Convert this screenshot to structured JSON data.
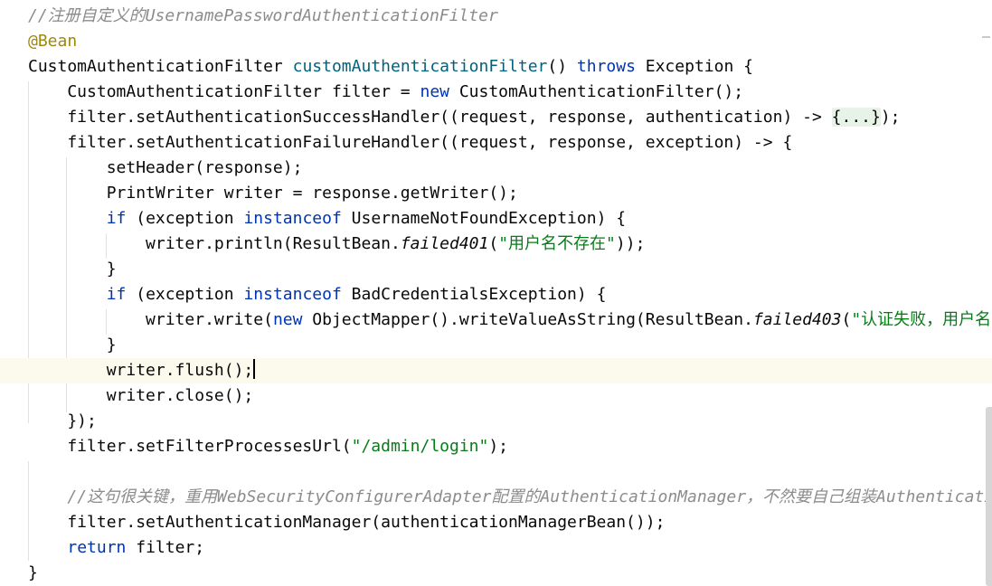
{
  "editor": {
    "lines": [
      {
        "segments": [
          {
            "t": "//注册自定义的UsernamePasswordAuthenticationFilter",
            "c": "cmt"
          }
        ]
      },
      {
        "segments": [
          {
            "t": "@Bean",
            "c": "ann"
          }
        ]
      },
      {
        "segments": [
          {
            "t": "CustomAuthenticationFilter ",
            "c": ""
          },
          {
            "t": "customAuthenticationFilter",
            "c": "fn"
          },
          {
            "t": "() ",
            "c": ""
          },
          {
            "t": "throws",
            "c": "kw"
          },
          {
            "t": " Exception {",
            "c": ""
          }
        ]
      },
      {
        "segments": [
          {
            "t": "    CustomAuthenticationFilter filter = ",
            "c": ""
          },
          {
            "t": "new",
            "c": "kw"
          },
          {
            "t": " CustomAuthenticationFilter();",
            "c": ""
          }
        ]
      },
      {
        "segments": [
          {
            "t": "    filter.setAuthenticationSuccessHandler((request, response, authentication) -> ",
            "c": ""
          },
          {
            "t": "{...}",
            "c": "fold"
          },
          {
            "t": ");",
            "c": ""
          }
        ]
      },
      {
        "segments": [
          {
            "t": "    filter.setAuthenticationFailureHandler((request, response, exception) -> {",
            "c": ""
          }
        ]
      },
      {
        "segments": [
          {
            "t": "        setHeader(response);",
            "c": ""
          }
        ]
      },
      {
        "segments": [
          {
            "t": "        PrintWriter writer = response.getWriter();",
            "c": ""
          }
        ]
      },
      {
        "segments": [
          {
            "t": "        ",
            "c": ""
          },
          {
            "t": "if",
            "c": "kw"
          },
          {
            "t": " (exception ",
            "c": ""
          },
          {
            "t": "instanceof",
            "c": "kw"
          },
          {
            "t": " UsernameNotFoundException) {",
            "c": ""
          }
        ]
      },
      {
        "segments": [
          {
            "t": "            writer.println(ResultBean.",
            "c": ""
          },
          {
            "t": "failed401",
            "c": "ital"
          },
          {
            "t": "(",
            "c": ""
          },
          {
            "t": "\"用户名不存在\"",
            "c": "str"
          },
          {
            "t": "));",
            "c": ""
          }
        ]
      },
      {
        "segments": [
          {
            "t": "        }",
            "c": ""
          }
        ]
      },
      {
        "segments": [
          {
            "t": "        ",
            "c": ""
          },
          {
            "t": "if",
            "c": "kw"
          },
          {
            "t": " (exception ",
            "c": ""
          },
          {
            "t": "instanceof",
            "c": "kw"
          },
          {
            "t": " BadCredentialsException) {",
            "c": ""
          }
        ]
      },
      {
        "segments": [
          {
            "t": "            writer.write(",
            "c": ""
          },
          {
            "t": "new",
            "c": "kw"
          },
          {
            "t": " ObjectMapper().writeValueAsString(ResultBean.",
            "c": ""
          },
          {
            "t": "failed403",
            "c": "ital"
          },
          {
            "t": "(",
            "c": ""
          },
          {
            "t": "\"认证失败，用户名",
            "c": "str"
          }
        ]
      },
      {
        "segments": [
          {
            "t": "        }",
            "c": ""
          }
        ]
      },
      {
        "segments": [
          {
            "t": "        writer.flush();",
            "c": ""
          }
        ],
        "current": true
      },
      {
        "segments": [
          {
            "t": "        writer.close();",
            "c": ""
          }
        ]
      },
      {
        "segments": [
          {
            "t": "    });",
            "c": ""
          }
        ]
      },
      {
        "segments": [
          {
            "t": "    filter.setFilterProcessesUrl(",
            "c": ""
          },
          {
            "t": "\"/admin/login\"",
            "c": "str"
          },
          {
            "t": ");",
            "c": ""
          }
        ]
      },
      {
        "segments": [
          {
            "t": "",
            "c": ""
          }
        ]
      },
      {
        "segments": [
          {
            "t": "    ",
            "c": ""
          },
          {
            "t": "//这句很关键，重用WebSecurityConfigurerAdapter配置的AuthenticationManager，不然要自己组装AuthenticationManager",
            "c": "cmt"
          }
        ]
      },
      {
        "segments": [
          {
            "t": "    filter.setAuthenticationManager(authenticationManagerBean());",
            "c": ""
          }
        ]
      },
      {
        "segments": [
          {
            "t": "    ",
            "c": ""
          },
          {
            "t": "return",
            "c": "kw"
          },
          {
            "t": " filter;",
            "c": ""
          }
        ]
      },
      {
        "segments": [
          {
            "t": "}",
            "c": ""
          }
        ]
      }
    ]
  }
}
